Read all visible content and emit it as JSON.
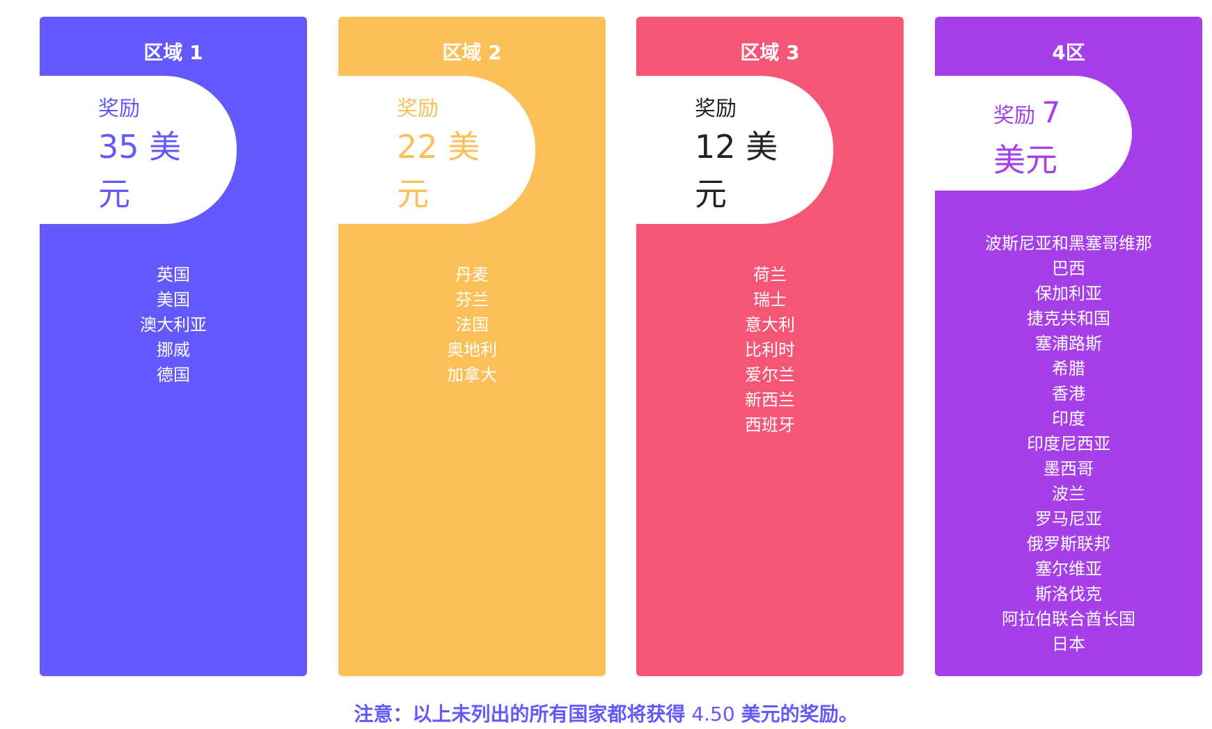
{
  "colors": {
    "zone1": "#6459fd",
    "zone2": "#fdbf58",
    "zone3": "#f65676",
    "zone4": "#a63fe9"
  },
  "zones": [
    {
      "title": "区域 1",
      "reward_label": "奖励",
      "reward_amount": "35 美元",
      "countries": [
        "英国",
        "美国",
        "澳大利亚",
        "挪威",
        "德国"
      ]
    },
    {
      "title": "区域 2",
      "reward_label": "奖励",
      "reward_amount": "22 美元",
      "countries": [
        "丹麦",
        "芬兰",
        "法国",
        "奥地利",
        "加拿大"
      ]
    },
    {
      "title": "区域 3",
      "reward_label": "奖励",
      "reward_amount": "12 美元",
      "countries": [
        "荷兰",
        "瑞士",
        "意大利",
        "比利时",
        "爱尔兰",
        "新西兰",
        "西班牙"
      ]
    },
    {
      "title": "4区",
      "reward_label": "奖励",
      "reward_number": "7",
      "reward_currency": "美元",
      "countries": [
        "波斯尼亚和黑塞哥维那",
        "巴西",
        "保加利亚",
        "捷克共和国",
        "塞浦路斯",
        "希腊",
        "香港",
        "印度",
        "印度尼西亚",
        "墨西哥",
        "波兰",
        "罗马尼亚",
        "俄罗斯联邦",
        "塞尔维亚",
        "斯洛伐克",
        "阿拉伯联合酋长国",
        "日本"
      ]
    }
  ],
  "note": {
    "prefix": "注意：以上未列出的所有国家都将获得",
    "amount": " 4.50 ",
    "suffix": "美元的奖励。"
  }
}
